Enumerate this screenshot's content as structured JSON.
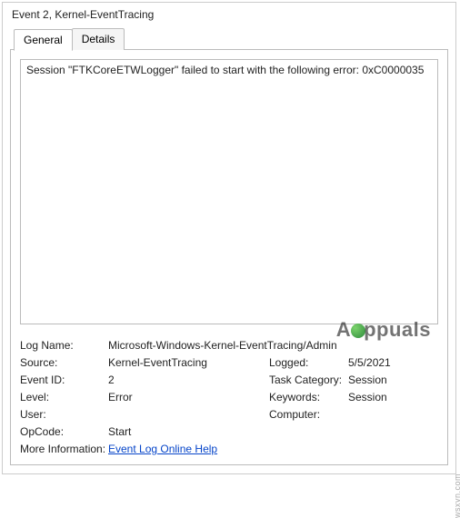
{
  "title": "Event 2, Kernel-EventTracing",
  "tabs": {
    "general": "General",
    "details": "Details"
  },
  "message": "Session \"FTKCoreETWLogger\" failed to start with the following error: 0xC0000035",
  "labels": {
    "logName": "Log Name:",
    "source": "Source:",
    "eventId": "Event ID:",
    "level": "Level:",
    "user": "User:",
    "opcode": "OpCode:",
    "moreInfo": "More Information:",
    "logged": "Logged:",
    "taskCategory": "Task Category:",
    "keywords": "Keywords:",
    "computer": "Computer:"
  },
  "values": {
    "logName": "Microsoft-Windows-Kernel-EventTracing/Admin",
    "source": "Kernel-EventTracing",
    "eventId": "2",
    "level": "Error",
    "user": "",
    "opcode": "Start",
    "moreInfoLink": "Event Log Online Help",
    "logged": "5/5/2021",
    "taskCategory": "Session",
    "keywords": "Session",
    "computer": ""
  },
  "watermark": "Appuals",
  "credit": "wsxyn.com"
}
